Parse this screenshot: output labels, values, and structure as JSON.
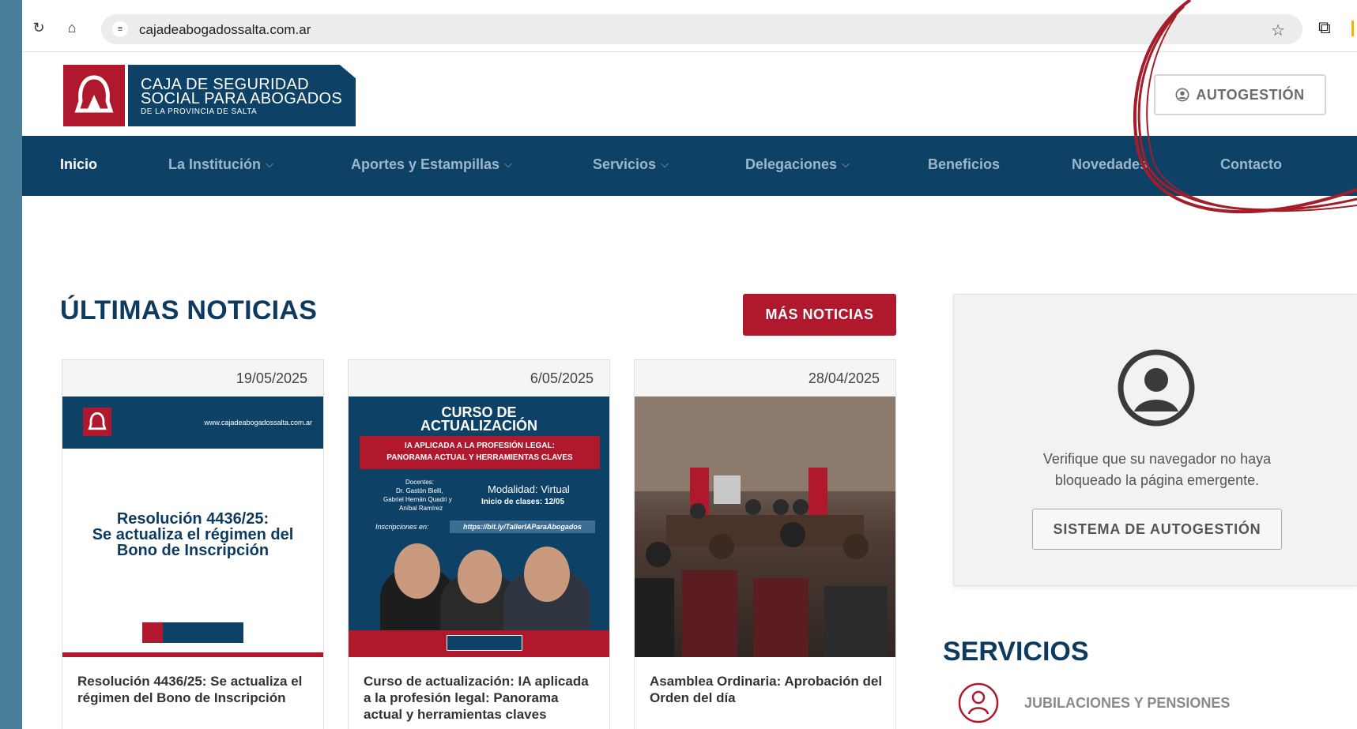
{
  "browser": {
    "url": "cajadeabogadossalta.com.ar",
    "reload_icon": "reload-icon",
    "home_icon": "home-icon",
    "bookmark_icon": "star-icon",
    "extensions_icon": "puzzle-icon"
  },
  "header": {
    "logo": {
      "line1": "CAJA DE SEGURIDAD",
      "line2": "SOCIAL PARA ABOGADOS",
      "line3": "DE LA PROVINCIA DE SALTA"
    },
    "autogestion_label": "AUTOGESTIÓN"
  },
  "nav": {
    "items": [
      {
        "label": "Inicio",
        "active": true
      },
      {
        "label": "La Institución",
        "dropdown": true
      },
      {
        "label": "Aportes y Estampillas",
        "dropdown": true
      },
      {
        "label": "Servicios",
        "dropdown": true
      },
      {
        "label": "Delegaciones",
        "dropdown": true
      },
      {
        "label": "Beneficios"
      },
      {
        "label": "Novedades"
      },
      {
        "label": "Contacto"
      }
    ]
  },
  "news": {
    "title": "ÚLTIMAS NOTICIAS",
    "more_label": "MÁS NOTICIAS",
    "cards": [
      {
        "date": "19/05/2025",
        "title": "Resolución 4436/25: Se actualiza el régimen del Bono de Inscripción",
        "image": {
          "url": "www.cajadeabogadossalta.com.ar",
          "line1": "Resolución 4436/25:",
          "line2": "Se actualiza el régimen del",
          "line3": "Bono de Inscripción"
        }
      },
      {
        "date": "6/05/2025",
        "title": "Curso de actualización: IA aplicada a la profesión legal: Panorama actual y herramientas claves",
        "image": {
          "heading1": "CURSO DE",
          "heading2": "ACTUALIZACIÓN",
          "band1": "IA APLICADA A LA PROFESIÓN LEGAL:",
          "band2": "PANORAMA ACTUAL Y HERRAMIENTAS CLAVES",
          "docentes_label": "Docentes:",
          "docente1": "Dr. Gastón Bielli,",
          "docente2": "Gabriel Hernán Quadri y",
          "docente3": "Aníbal Ramírez",
          "modalidad": "Modalidad: Virtual",
          "inicio": "Inicio de clases: 12/05",
          "inscripciones_label": "Inscripciones en:",
          "link": "https://bit.ly/TallerIAParaAbogados"
        }
      },
      {
        "date": "28/04/2025",
        "title": "Asamblea Ordinaria: Aprobación del Orden del día"
      }
    ]
  },
  "popup": {
    "message_line1": "Verifique que su navegador no haya",
    "message_line2": "bloqueado la página emergente.",
    "button_label": "SISTEMA DE AUTOGESTIÓN"
  },
  "servicios": {
    "title": "SERVICIOS",
    "items": [
      {
        "label": "JUBILACIONES Y PENSIONES",
        "icon": "retiree-icon"
      }
    ]
  },
  "colors": {
    "brand_blue": "#0d4266",
    "brand_red": "#b0182e",
    "nav_text": "#9db6ca"
  }
}
